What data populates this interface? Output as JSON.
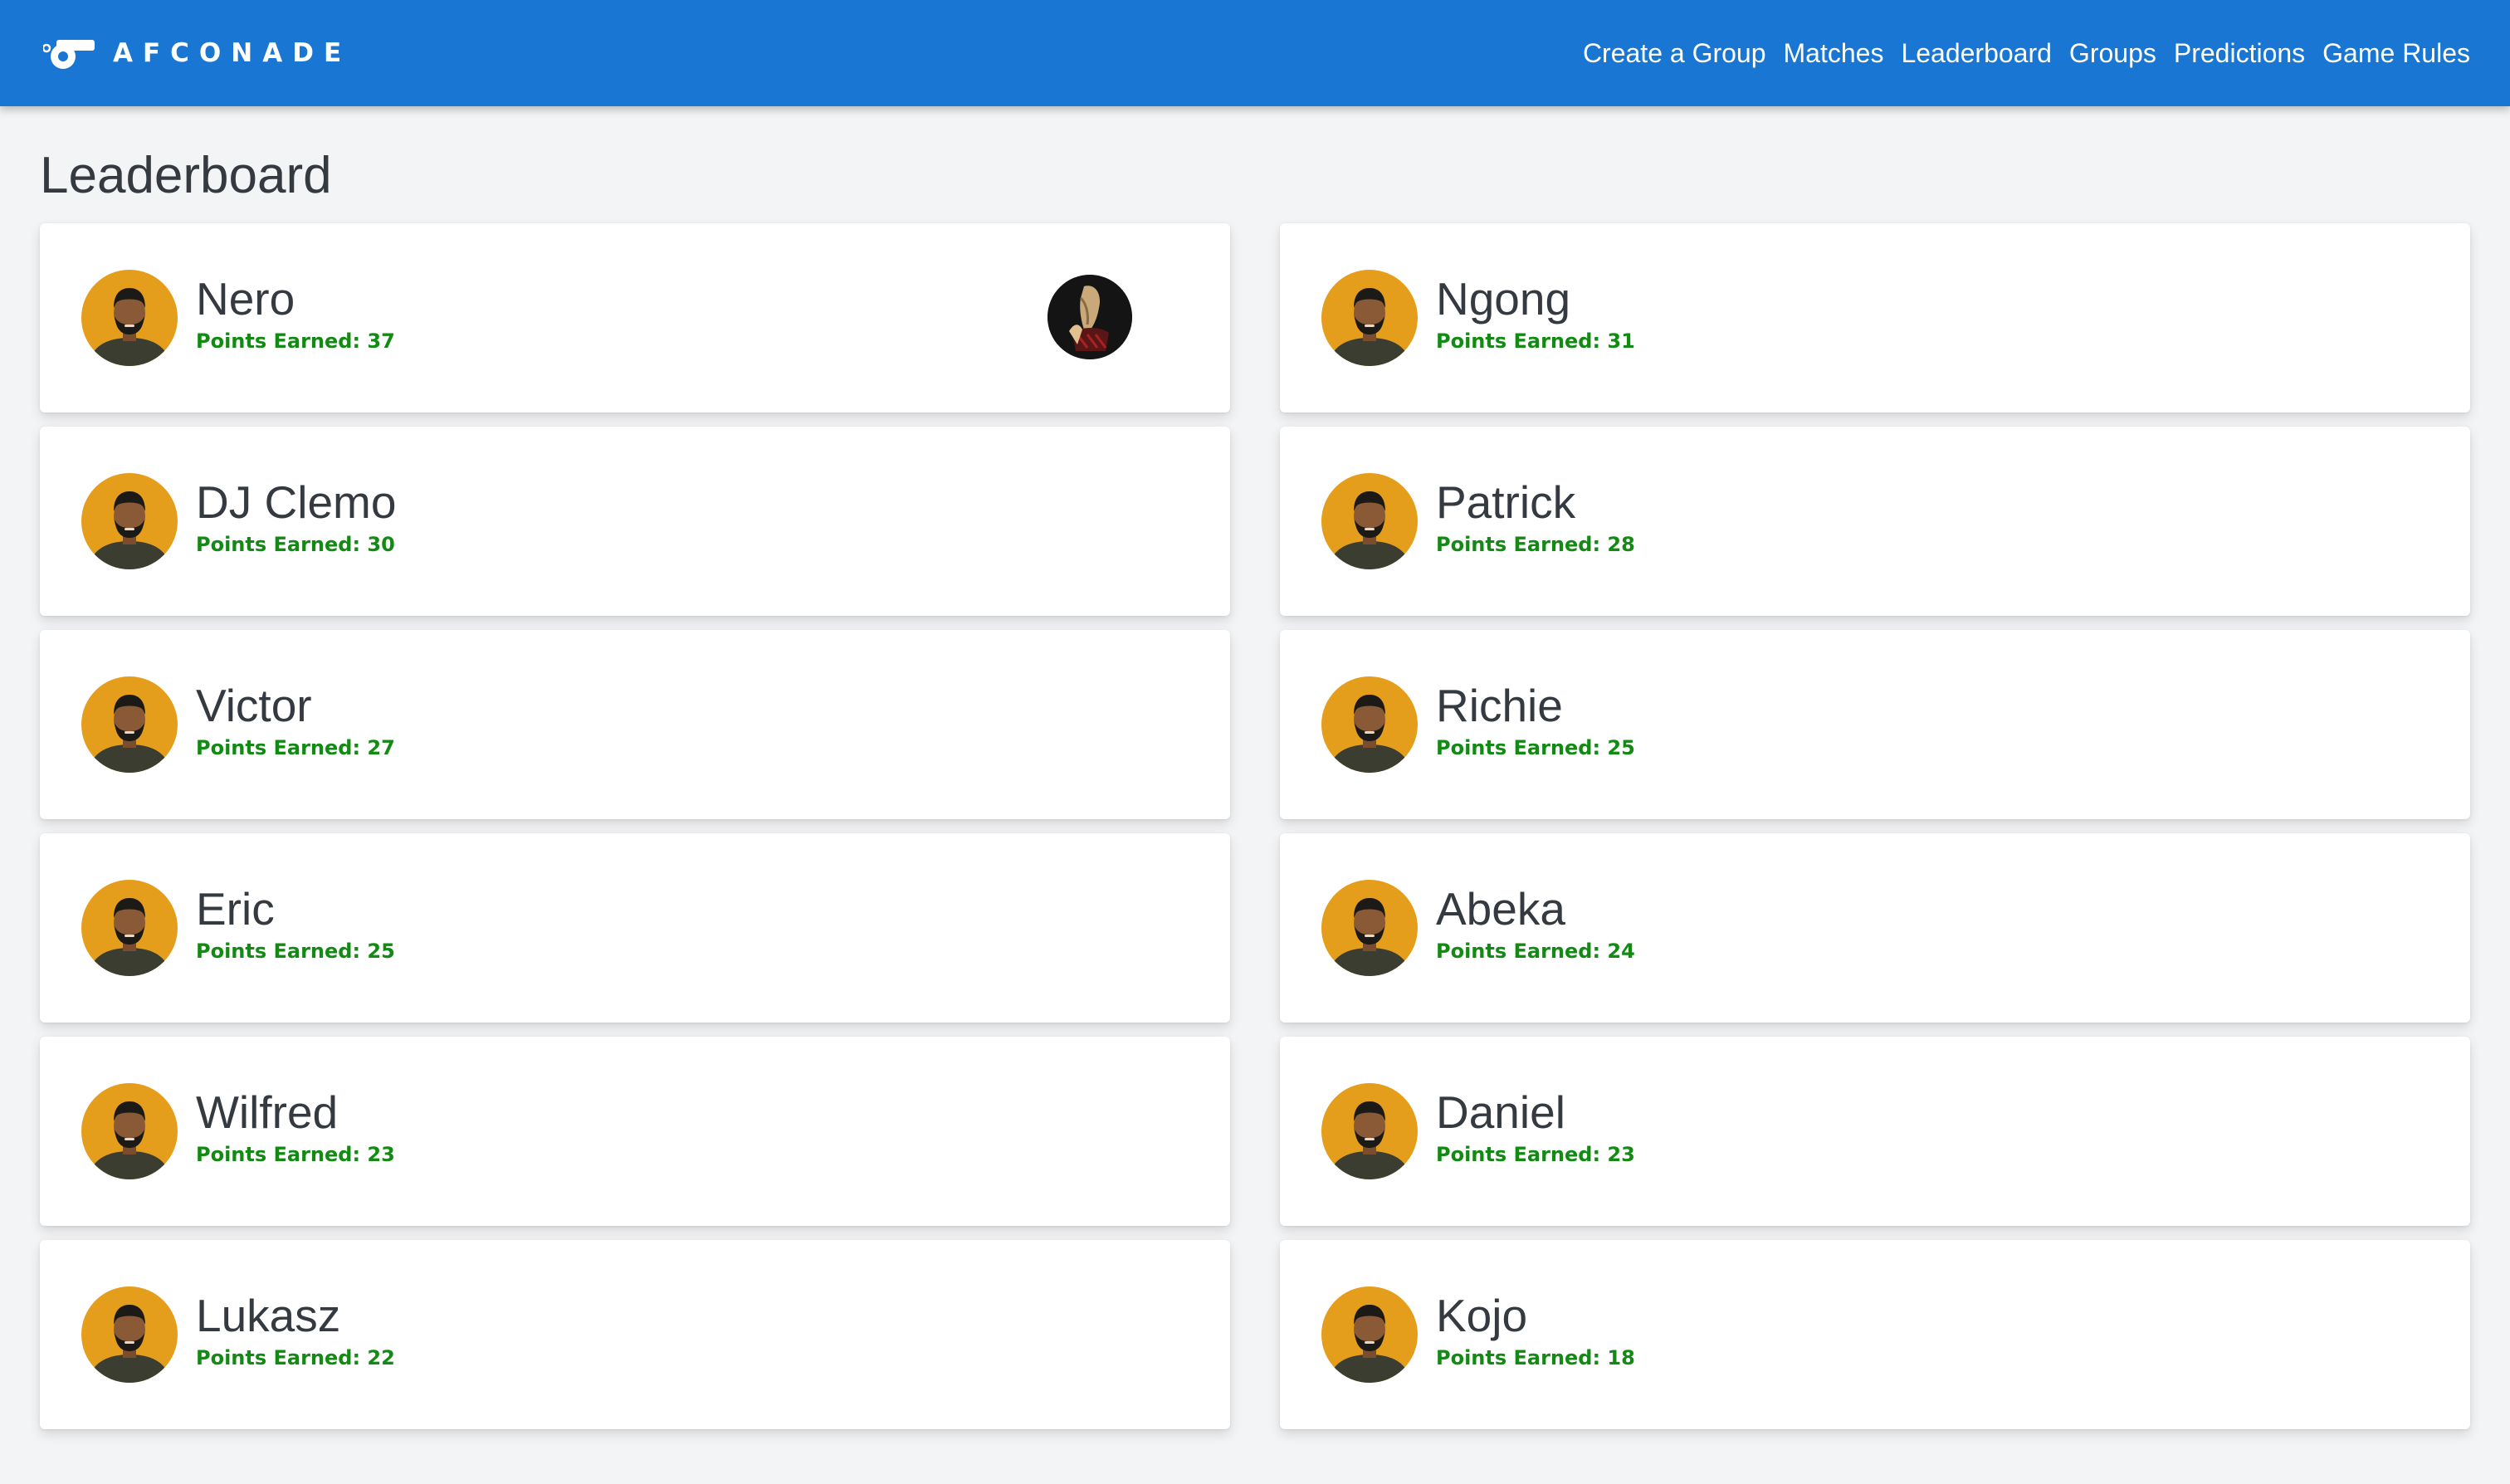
{
  "app": {
    "brand": "AFCONADE"
  },
  "nav": {
    "items": [
      {
        "label": "Create a Group"
      },
      {
        "label": "Matches"
      },
      {
        "label": "Leaderboard"
      },
      {
        "label": "Groups"
      },
      {
        "label": "Predictions"
      },
      {
        "label": "Game Rules"
      }
    ]
  },
  "page": {
    "title": "Leaderboard"
  },
  "points_label": "Points Earned:",
  "players": [
    {
      "name": "Nero",
      "points": "Points Earned: 37"
    },
    {
      "name": "Ngong",
      "points": "Points Earned: 31"
    },
    {
      "name": "DJ Clemo",
      "points": "Points Earned: 30"
    },
    {
      "name": "Patrick",
      "points": "Points Earned: 28"
    },
    {
      "name": "Victor",
      "points": "Points Earned: 27"
    },
    {
      "name": "Richie",
      "points": "Points Earned: 25"
    },
    {
      "name": "Eric",
      "points": "Points Earned: 25"
    },
    {
      "name": "Abeka",
      "points": "Points Earned: 24"
    },
    {
      "name": "Wilfred",
      "points": "Points Earned: 23"
    },
    {
      "name": "Daniel",
      "points": "Points Earned: 23"
    },
    {
      "name": "Lukasz",
      "points": "Points Earned: 22"
    },
    {
      "name": "Kojo",
      "points": "Points Earned: 18"
    }
  ],
  "icons": {
    "brand": "whistle-icon",
    "avatar": "avatar-placeholder-icon",
    "badge": "trophy-badge-icon"
  },
  "colors": {
    "navbar": "#1976d2",
    "background": "#f3f4f6",
    "points_text": "#138a13",
    "avatar_bg": "#e59e1c",
    "text": "#343a40"
  }
}
